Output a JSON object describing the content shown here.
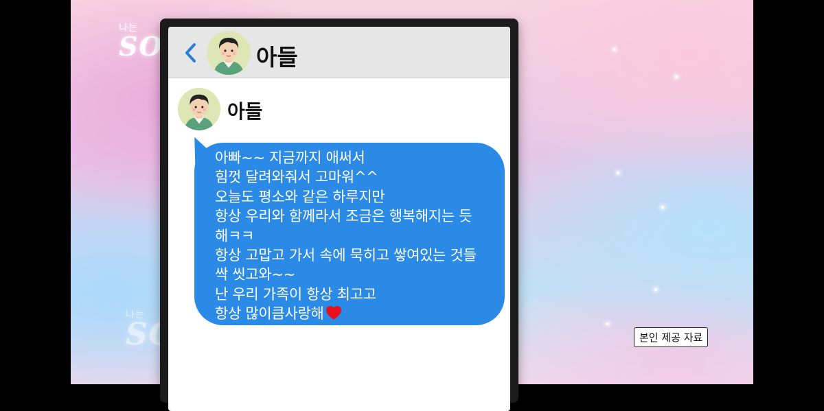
{
  "logo": {
    "top_small": "나는",
    "top_big": "SOLO",
    "bottom_small": "나는",
    "bottom_big": "SOLO"
  },
  "chat": {
    "header_name": "아들",
    "sender_name": "아들",
    "message_lines": [
      "아빠~~ 지금까지 애써서",
      "힘껏 달려와줘서 고마워^^",
      "오늘도 평소와 같은 하루지만",
      "항상 우리와 함께라서 조금은 행복해지는 듯",
      "해ㅋㅋ",
      "항상 고맙고 가서 속에 묵히고 쌓여있는 것들",
      "싹 씻고와~~",
      "난 우리 가족이 항상 최고고",
      "항상 많이큼사랑해"
    ]
  },
  "caption": "본인 제공 자료",
  "icons": {
    "back": "chevron-left-icon",
    "heart": "heart-icon"
  },
  "colors": {
    "bubble": "#2a8ae6",
    "back_chevron": "#2a7fd4",
    "heart": "#e8101c"
  }
}
